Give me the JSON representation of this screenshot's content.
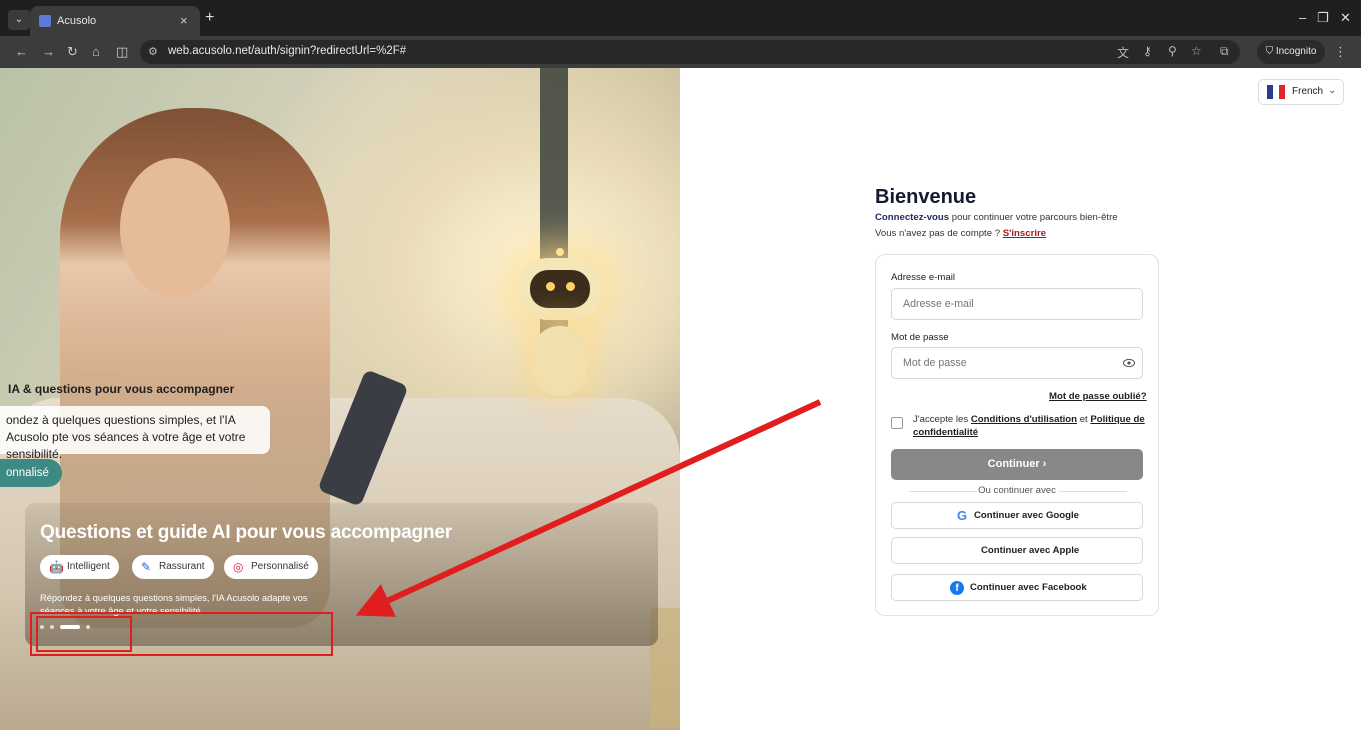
{
  "browser": {
    "tab_title": "Acusolo",
    "url": "web.acusolo.net/auth/signin?redirectUrl=%2F#",
    "incognito_label": "Incognito"
  },
  "language": {
    "label": "French",
    "flag": [
      "#2a3b8f",
      "#ffffff",
      "#e0262b"
    ]
  },
  "hero": {
    "partial_title": "IA & questions pour vous accompagner",
    "partial_desc": "ondez à quelques questions simples, et l'IA Acusolo pte vos séances à votre âge et votre sensibilité.",
    "partial_pill": "onnalisé",
    "card_title": "Questions et guide AI pour vous accompagner",
    "chips": [
      {
        "label": "Intelligent",
        "icon": "robot-icon",
        "color": "#3b5bdb"
      },
      {
        "label": "Rassurant",
        "icon": "feather-icon",
        "color": "#2563eb"
      },
      {
        "label": "Personnalisé",
        "icon": "target-icon",
        "color": "#e11d48"
      }
    ],
    "card_desc": "Répondez à quelques questions simples, l'IA Acusolo adapte vos séances à votre âge et votre sensibilité.",
    "carousel_active": 3
  },
  "login": {
    "title": "Bienvenue",
    "sub_bold": "Connectez-vous",
    "sub_rest": " pour continuer votre parcours bien-être",
    "no_account": "Vous n'avez pas de compte ? ",
    "signup_link": "S'inscrire",
    "email_label": "Adresse e-mail",
    "email_placeholder": "Adresse e-mail",
    "password_label": "Mot de passe",
    "password_placeholder": "Mot de passe",
    "forgot": "Mot de passe oublié?",
    "accept_pre": "J'accepte les ",
    "terms": "Conditions d'utilisation",
    "accept_mid": " et ",
    "privacy": "Politique de confidentialité",
    "continue": "Continuer",
    "or_continue": "Ou continuer avec",
    "google": "Continuer avec Google",
    "apple": "Continuer avec Apple",
    "facebook": "Continuer avec Facebook"
  }
}
